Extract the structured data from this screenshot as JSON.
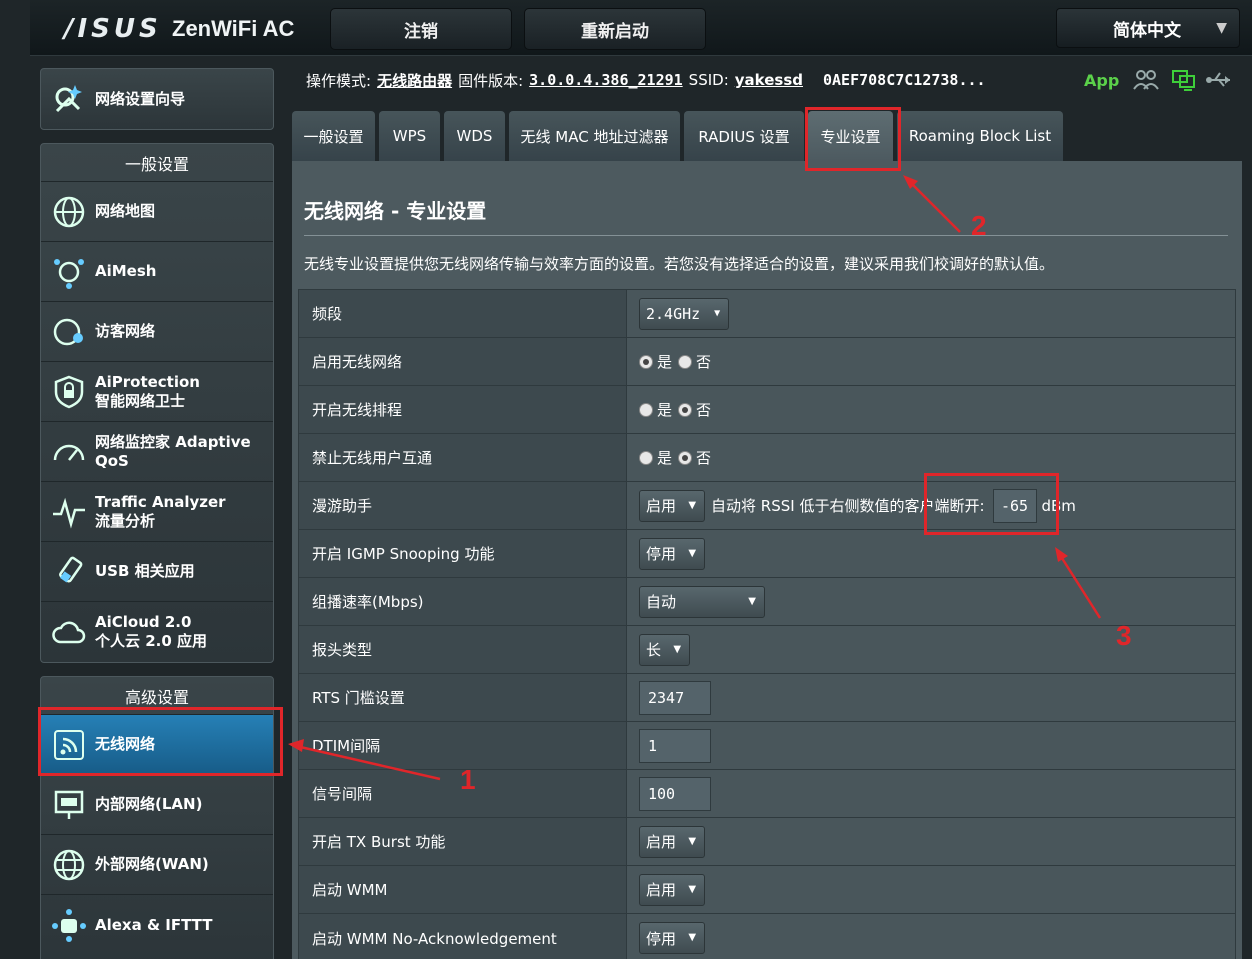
{
  "header": {
    "logo": "/ISUS",
    "model": "ZenWiFi AC",
    "logout_label": "注销",
    "reboot_label": "重新启动",
    "language": "简体中文"
  },
  "status": {
    "mode_label": "操作模式:",
    "mode_value": "无线路由器",
    "fw_label": "固件版本:",
    "fw_value": "3.0.0.4.386_21291",
    "ssid_label": "SSID:",
    "ssid_value": "yakessd",
    "mac_value": "0AEF708C7C12738...",
    "app_label": "App"
  },
  "sidebar": {
    "wizard": "网络设置向导",
    "general_title": "一般设置",
    "general_items": [
      {
        "line1": "网络地图",
        "line2": ""
      },
      {
        "line1": "AiMesh",
        "line2": ""
      },
      {
        "line1": "访客网络",
        "line2": ""
      },
      {
        "line1": "AiProtection",
        "line2": "智能网络卫士"
      },
      {
        "line1": "网络监控家 Adaptive",
        "line2": "QoS"
      },
      {
        "line1": "Traffic Analyzer",
        "line2": "流量分析"
      },
      {
        "line1": "USB 相关应用",
        "line2": ""
      },
      {
        "line1": "AiCloud 2.0",
        "line2": "个人云 2.0 应用"
      }
    ],
    "advanced_title": "高级设置",
    "advanced_items": [
      {
        "line1": "无线网络"
      },
      {
        "line1": "内部网络(LAN)"
      },
      {
        "line1": "外部网络(WAN)"
      },
      {
        "line1": "Alexa & IFTTT"
      }
    ]
  },
  "tabs": [
    "一般设置",
    "WPS",
    "WDS",
    "无线 MAC 地址过滤器",
    "RADIUS 设置",
    "专业设置",
    "Roaming Block List"
  ],
  "panel": {
    "title": "无线网络 - 专业设置",
    "description": "无线专业设置提供您无线网络传输与效率方面的设置。若您没有选择适合的设置，建议采用我们校调好的默认值。",
    "yes": "是",
    "no": "否",
    "rows": {
      "band_label": "频段",
      "band_value": "2.4GHz",
      "enable_wl_label": "启用无线网络",
      "sched_label": "开启无线排程",
      "isolate_label": "禁止无线用户互通",
      "roam_label": "漫游助手",
      "roam_value": "启用",
      "roam_desc": "自动将 RSSI 低于右侧数值的客户端断开:",
      "roam_rssi": "-65",
      "roam_unit": "dBm",
      "igmp_label": "开启 IGMP Snooping 功能",
      "igmp_value": "停用",
      "mcast_label": "组播速率(Mbps)",
      "mcast_value": "自动",
      "preamble_label": "报头类型",
      "preamble_value": "长",
      "rts_label": "RTS 门槛设置",
      "rts_value": "2347",
      "dtim_label": "DTIM间隔",
      "dtim_value": "1",
      "beacon_label": "信号间隔",
      "beacon_value": "100",
      "txburst_label": "开启 TX Burst 功能",
      "txburst_value": "启用",
      "wmm_label": "启动 WMM",
      "wmm_value": "启用",
      "wmmnoack_label": "启动 WMM No-Acknowledgement",
      "wmmnoack_value": "停用"
    }
  },
  "annotations": [
    "1",
    "2",
    "3"
  ],
  "colors": {
    "accent_active": "#2680b6",
    "annotation_red": "#e0262a",
    "app_green": "#5bd14a"
  }
}
